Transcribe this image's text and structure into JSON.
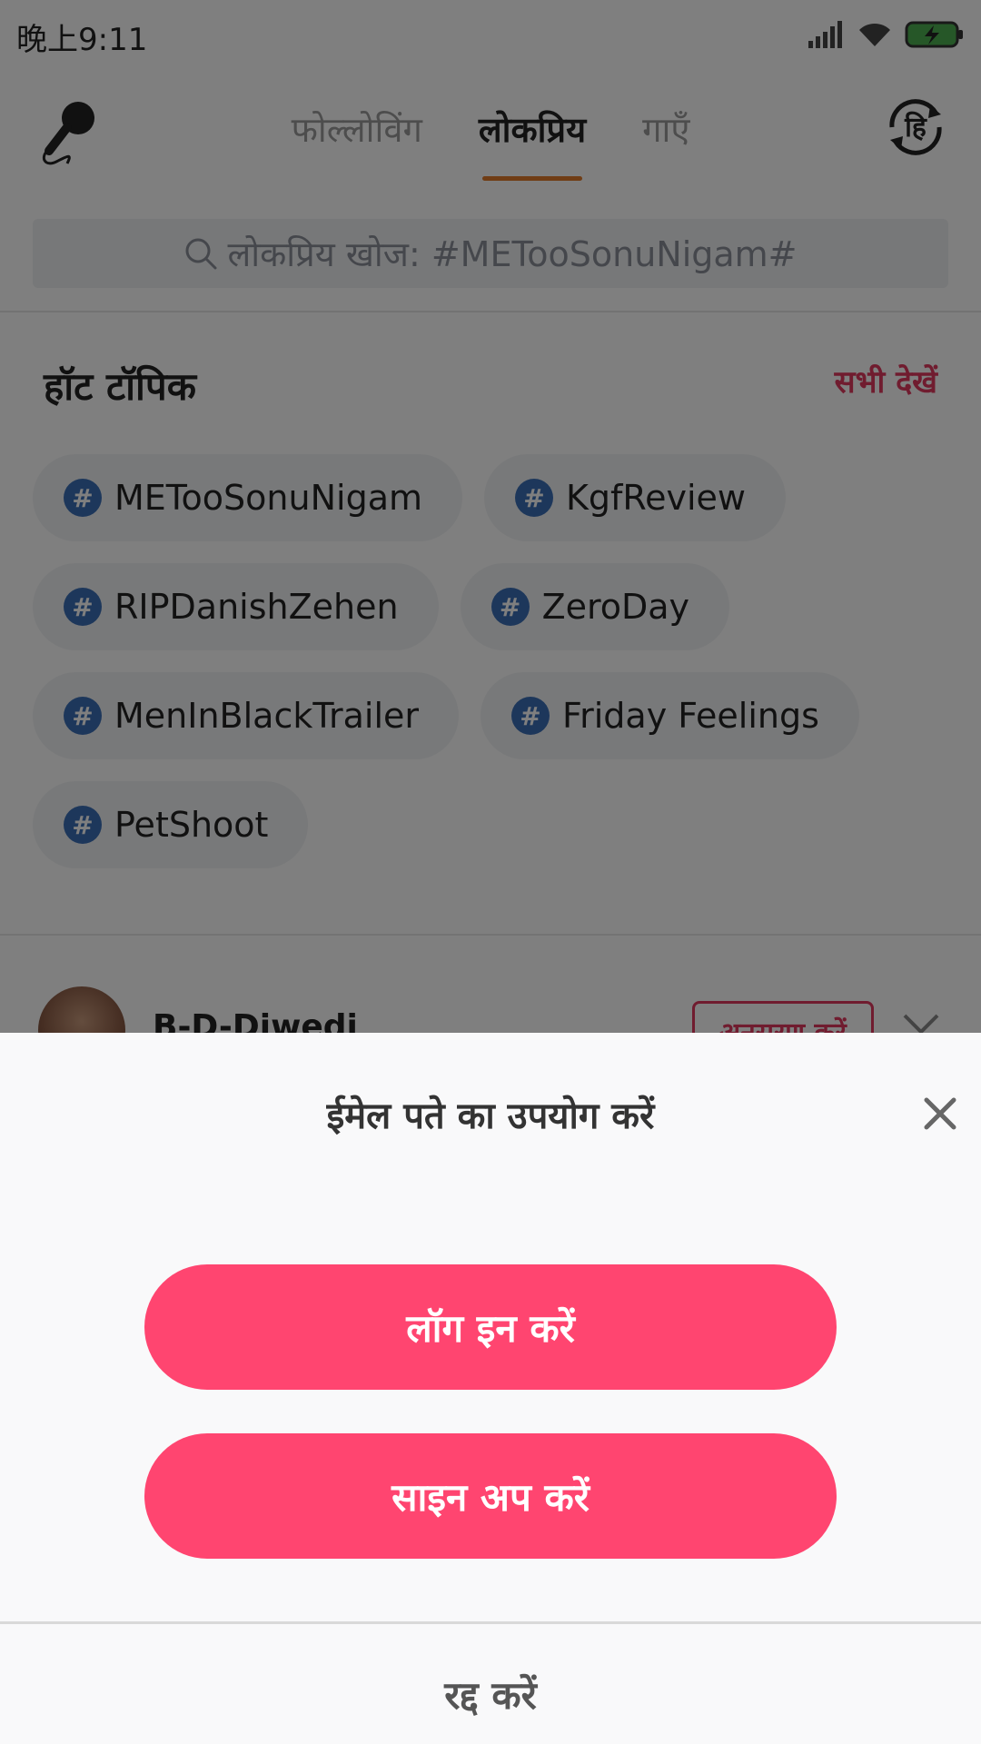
{
  "status_bar": {
    "time": "晚上9:11"
  },
  "nav": {
    "tabs": [
      {
        "label": "फोल्लोविंग"
      },
      {
        "label": "लोकप्रिय"
      },
      {
        "label": "गाएँ"
      }
    ],
    "active_tab": "लोकप्रिय",
    "language_badge": "हि"
  },
  "search": {
    "placeholder": "लोकप्रिय खोज: #METooSonuNigam#"
  },
  "hot_topics": {
    "title": "हॉट टॉपिक",
    "see_all": "सभी देखें",
    "hash_symbol": "#",
    "tags": [
      "METooSonuNigam",
      "KgfReview",
      "RIPDanishZehen",
      "ZeroDay",
      "MenInBlackTrailer",
      "Friday Feelings",
      "PetShoot"
    ]
  },
  "post": {
    "username": "B-D-Diwedi",
    "follow_label": "अनुसरण करें"
  },
  "sheet": {
    "title": "ईमेल पते का उपयोग करें",
    "login_label": "लॉग इन करें",
    "signup_label": "साइन अप करें",
    "cancel_label": "रद्द करें"
  },
  "colors": {
    "accent": "#ff4570",
    "tab_underline": "#e07a2a",
    "hash_badge": "#3b6fb6",
    "see_all": "#e0385e"
  }
}
